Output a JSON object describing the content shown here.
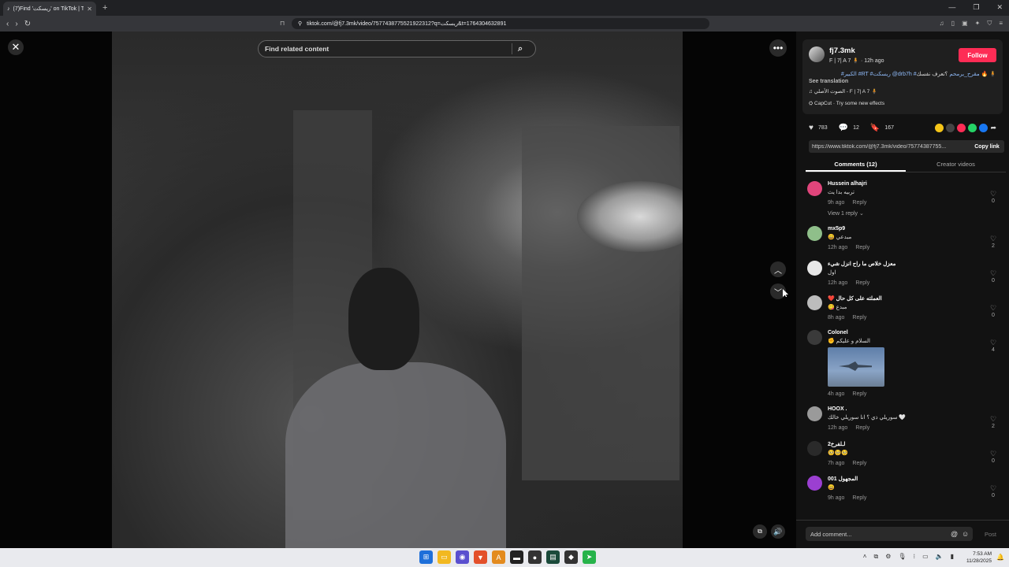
{
  "browser": {
    "tab_title": "(7)Find 'ريسكت' on TikTok | T",
    "tab_close": "✕",
    "new_tab": "+",
    "url": "tiktok.com/@fj7.3mk/video/7577438775521922312?q=ريسكت&t=1764304632891",
    "window_controls": [
      "—",
      "❐",
      "✕"
    ]
  },
  "video": {
    "search_placeholder": "Find related content",
    "close_symbol": "✕",
    "more_symbol": "•••",
    "up_symbol": "︿",
    "down_symbol": "﹀",
    "pip_symbol": "⧉",
    "volume_symbol": "🔊"
  },
  "author": {
    "username": "fj7.3mk",
    "subtitle": "F | 7| A 7 🧍 · 12h ago",
    "follow_label": "Follow",
    "caption_prefix": "؟تعرف نفسك 🔥 🧍 ",
    "caption_tags": "#الكبير #RT #ريسكت @drb7h #مقرح_يرمحم",
    "see_translation": "See translation",
    "music": "♫ الصوت الأصلي - F | 7| A 7 🧍",
    "effect": "⛭ CapCut · Try some new effects"
  },
  "stats": {
    "likes": "783",
    "comments": "12",
    "saves": "167"
  },
  "share": {
    "link": "https://www.tiktok.com/@fj7.3mk/video/75774387755...",
    "copy_label": "Copy link",
    "colors": [
      "#f5c518",
      "#444444",
      "#fe2c55",
      "#25d366",
      "#1877f2"
    ]
  },
  "tabs": {
    "comments": "Comments (12)",
    "creator": "Creator videos"
  },
  "comments": [
    {
      "name": "Hussein alhajri",
      "text": "تربيه بدا يث",
      "time": "9h ago",
      "reply": "Reply",
      "likes": "0",
      "replies": "View 1 reply ⌄",
      "color": "#e0457b"
    },
    {
      "name": "mx5p9",
      "text": "😄 مبدعي",
      "time": "12h ago",
      "reply": "Reply",
      "likes": "2",
      "color": "#8fbf8a"
    },
    {
      "name": "معزل خلاص ما راح انزل شيء",
      "text": "اول",
      "time": "12h ago",
      "reply": "Reply",
      "likes": "0",
      "color": "#e6e6e6"
    },
    {
      "name": "❤️ العملته على كل حال",
      "text": "😋 مبدع",
      "time": "8h ago",
      "reply": "Reply",
      "likes": "0",
      "color": "#bcbcbc"
    },
    {
      "name": "Colonel",
      "text": "✊ السلام و عليكم",
      "time": "4h ago",
      "reply": "Reply",
      "likes": "4",
      "color": "#3a3a3a"
    },
    {
      "name": "HOOX .",
      "text": "سوريلي ذي ؟ انا سوريلي خالك 🤍",
      "time": "12h ago",
      "reply": "Reply",
      "likes": "2",
      "color": "#9a9a9a"
    },
    {
      "name": "2لـلفرخ",
      "text": "🥺🥺🥺",
      "time": "7h ago",
      "reply": "Reply",
      "likes": "0",
      "color": "#2a2a2a"
    },
    {
      "name": "المجهول 001",
      "text": "😀",
      "time": "9h ago",
      "reply": "Reply",
      "likes": "0",
      "color": "#9b3fd1"
    }
  ],
  "composer": {
    "placeholder": "Add comment...",
    "at": "@",
    "emoji": "☺",
    "post": "Post"
  },
  "taskbar": {
    "time": "7:53 AM",
    "date": "11/28/2025"
  }
}
